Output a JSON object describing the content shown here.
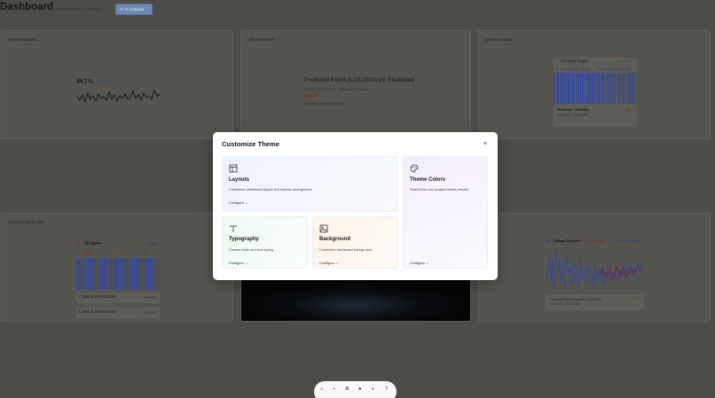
{
  "header": {
    "title": "Dashboard",
    "select_value": "Select component to analyze...",
    "ai_button": "AI Analysis"
  },
  "cards": {
    "alignment": {
      "title": "Cultural Alignment",
      "value": "49.5%",
      "delta": "↗ 36.0%"
    },
    "periods": {
      "title": "Cultural Periods",
      "event_title": "Predicted Event (1/23/2024) (AI Predicted)",
      "range": "2024-01-23T00:00:00 - 2024-01-23T00:00:00",
      "level": "HIGH",
      "expected": "Expected change: 2239.25%"
    },
    "decision": {
      "title": "Decision Impact",
      "heading": "Decision Impact",
      "change": "-14.9%",
      "cultural": "Cultural Periods: 56.5%",
      "normal": "Normal Periods: 37.4%",
      "period": "Weekend - Saturday",
      "pct": "-36.7%",
      "date": "1/20/2024 - 1/20/2024"
    },
    "alerts": {
      "title": "Cultural Pattern Alerts",
      "count": "38 Alerts",
      "pct_up": "6.85%",
      "pct_down": "6.85%",
      "high": "High",
      "med": "Med",
      "low": "Low",
      "item1": "Cultural Period Alert",
      "time1": "7:00 PM",
      "item2": "Cultural Period Alert",
      "time2": "6:00 PM"
    },
    "impact": {
      "title": "...ts",
      "heading": "Volume Patterns",
      "impact": "-2.75 Impact",
      "conf": "87% Confidence",
      "box_title": "Cultural Period Impact 1/23/2024",
      "box_pct": "+9.5%",
      "box_date": "1/23/2024 - 1/23/2024"
    }
  },
  "modal": {
    "title": "Customize Theme",
    "close": "×",
    "options": {
      "layouts": {
        "name": "Layouts",
        "desc": "Customize dashboard layout and metrics arrangement",
        "cta": "Configure →"
      },
      "colors": {
        "name": "Theme Colors",
        "desc": "Select from our curated theme presets",
        "cta": "Configure →"
      },
      "typography": {
        "name": "Typography",
        "desc": "Choose fonts and text styling",
        "cta": "Configure →"
      },
      "background": {
        "name": "Background",
        "desc": "Customize dashboard background",
        "cta": "Configure →"
      }
    }
  },
  "dock": {
    "items": [
      "home-icon",
      "chart-icon",
      "bars-icon",
      "user-icon",
      "palette-icon",
      "help-icon"
    ]
  },
  "colors": {
    "accent": "#6f8ab0",
    "bars": "#2c44a8",
    "danger": "#8a1c1c"
  }
}
